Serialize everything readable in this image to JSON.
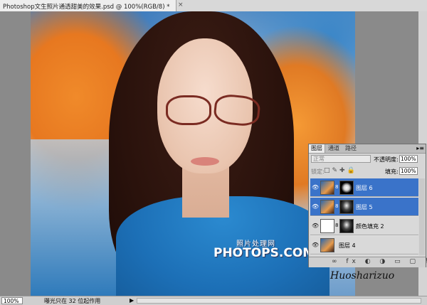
{
  "document": {
    "tab_title": "Photoshop文生照片通透甜美的效果.psd @ 100%(RGB/8)",
    "modified_mark": "*",
    "close_glyph": "×"
  },
  "watermark": {
    "cn": "照片处理网",
    "en": "PHOTOPS.COM"
  },
  "signature": "Huosharizuo",
  "status_bar": {
    "zoom": "100%",
    "info": "曝光只在 32 位起作用",
    "arrow": "▶"
  },
  "layers_panel": {
    "tabs": [
      "图层",
      "通道",
      "路径"
    ],
    "menu_glyph": "▸≡",
    "blend_mode": "正常",
    "opacity_label": "不透明度:",
    "opacity_value": "100%",
    "lock_label": "锁定:",
    "lock_icons": "□✎✚🔒",
    "fill_label": "填充:",
    "fill_value": "100%",
    "layers": [
      {
        "name": "图层 6",
        "selected": true
      },
      {
        "name": "图层 5",
        "selected": true
      },
      {
        "name": "颜色填充 2",
        "selected": false
      },
      {
        "name": "图层 4",
        "selected": false
      }
    ],
    "footer_icons": "∞ fx ◐ ◑ ▭ ▢ 🗑"
  }
}
